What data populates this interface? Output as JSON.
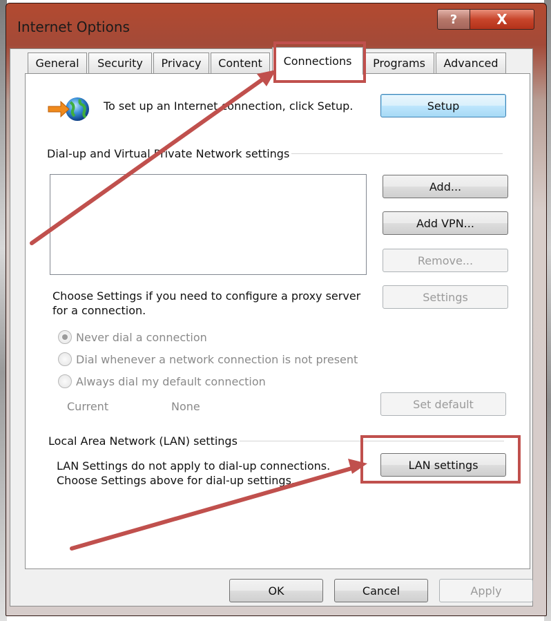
{
  "window": {
    "title": "Internet Options",
    "help_label": "?",
    "close_label": "X"
  },
  "tabs": [
    {
      "label": "General",
      "selected": false
    },
    {
      "label": "Security",
      "selected": false
    },
    {
      "label": "Privacy",
      "selected": false
    },
    {
      "label": "Content",
      "selected": false
    },
    {
      "label": "Connections",
      "selected": true
    },
    {
      "label": "Programs",
      "selected": false
    },
    {
      "label": "Advanced",
      "selected": false
    }
  ],
  "connections": {
    "setup_text": "To set up an Internet connection, click Setup.",
    "setup_button": "Setup",
    "dialup_group_label": "Dial-up and Virtual Private Network settings",
    "add_button": "Add...",
    "add_vpn_button": "Add VPN...",
    "remove_button": "Remove...",
    "proxy_text": "Choose Settings if you need to configure a proxy server for a connection.",
    "settings_button": "Settings",
    "radio_options": [
      {
        "label": "Never dial a connection",
        "checked": true
      },
      {
        "label": "Dial whenever a network connection is not present",
        "checked": false
      },
      {
        "label": "Always dial my default connection",
        "checked": false
      }
    ],
    "current_label": "Current",
    "current_value": "None",
    "set_default_button": "Set default",
    "lan_group_label": "Local Area Network (LAN) settings",
    "lan_text": "LAN Settings do not apply to dial-up connections. Choose Settings above for dial-up settings.",
    "lan_settings_button": "LAN settings"
  },
  "footer": {
    "ok_button": "OK",
    "cancel_button": "Cancel",
    "apply_button": "Apply"
  },
  "colors": {
    "annotation_red": "#c0504d",
    "focus_blue": "#3c7fb1"
  }
}
